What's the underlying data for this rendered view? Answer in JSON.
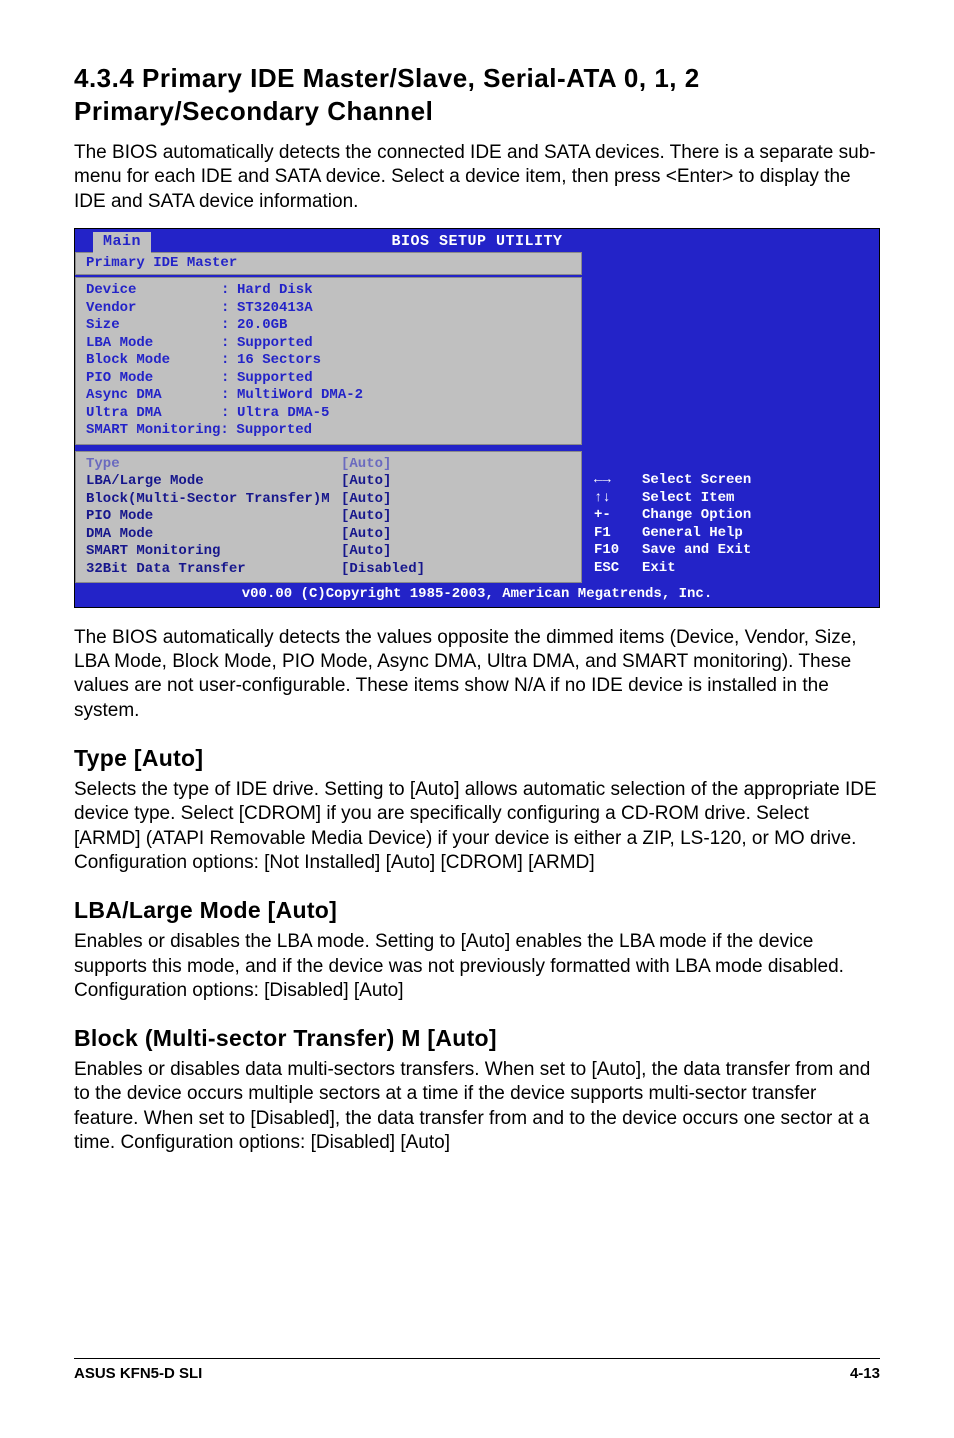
{
  "section_title": "4.3.4 Primary IDE Master/Slave, Serial-ATA 0, 1, 2 Primary/Secondary Channel",
  "intro": "The BIOS automatically detects the connected IDE and SATA devices. There is a separate sub-menu for each IDE and SATA device. Select a device item, then press <Enter> to display the IDE and SATA device information.",
  "bios": {
    "utility_title": "BIOS SETUP UTILITY",
    "tab": "Main",
    "panel_title": "Primary IDE Master",
    "info": [
      {
        "label": "Device",
        "value": "Hard Disk"
      },
      {
        "label": "Vendor",
        "value": "ST320413A"
      },
      {
        "label": "Size",
        "value": "20.0GB"
      },
      {
        "label": "LBA Mode",
        "value": "Supported"
      },
      {
        "label": "Block Mode",
        "value": "16 Sectors"
      },
      {
        "label": "PIO Mode",
        "value": "Supported"
      },
      {
        "label": "Async DMA",
        "value": "MultiWord DMA-2"
      },
      {
        "label": "Ultra DMA",
        "value": "Ultra DMA-5"
      },
      {
        "label": "SMART Monitoring",
        "value": "Supported",
        "nocolon": true
      }
    ],
    "options": [
      {
        "label": "Type",
        "value": "[Auto]",
        "dim": true
      },
      {
        "label": "LBA/Large Mode",
        "value": "[Auto]"
      },
      {
        "label": "Block(Multi-Sector Transfer)M",
        "value": "[Auto]"
      },
      {
        "label": "PIO Mode",
        "value": "[Auto]"
      },
      {
        "label": "DMA Mode",
        "value": "[Auto]"
      },
      {
        "label": "SMART Monitoring",
        "value": "[Auto]"
      },
      {
        "label": "32Bit Data Transfer",
        "value": "[Disabled]"
      }
    ],
    "nav": [
      {
        "key": "←→",
        "label": "Select Screen"
      },
      {
        "key": "↑↓",
        "label": "Select Item"
      },
      {
        "key": "+-",
        "label": "Change Option"
      },
      {
        "key": "F1",
        "label": "General Help"
      },
      {
        "key": "F10",
        "label": "Save and Exit"
      },
      {
        "key": "ESC",
        "label": "Exit"
      }
    ],
    "footer": "v00.00 (C)Copyright 1985-2003, American Megatrends, Inc."
  },
  "para2": "The BIOS automatically detects the values opposite the dimmed items (Device, Vendor, Size, LBA Mode, Block Mode, PIO Mode, Async DMA, Ultra DMA, and SMART monitoring). These values are not user-configurable. These items show N/A if no IDE device is installed in the system.",
  "type_heading": "Type [Auto]",
  "type_body": "Selects the type of IDE drive. Setting to [Auto] allows automatic selection of the appropriate IDE device type. Select [CDROM] if you are specifically configuring a CD-ROM drive. Select [ARMD] (ATAPI Removable Media Device) if your device is either a ZIP, LS-120, or MO drive.\nConfiguration options: [Not Installed] [Auto] [CDROM] [ARMD]",
  "lba_heading": "LBA/Large Mode [Auto]",
  "lba_body": "Enables or disables the LBA mode. Setting to [Auto] enables the LBA mode if the device supports this mode, and if the device was not previously formatted with LBA mode disabled. Configuration options: [Disabled] [Auto]",
  "block_heading": "Block (Multi-sector Transfer) M [Auto]",
  "block_body": "Enables or disables data multi-sectors transfers. When set to [Auto], the data transfer from and to the device occurs multiple sectors at a time if the device supports multi-sector transfer feature. When set to [Disabled], the data transfer from and to the device occurs one sector at a time. Configuration options: [Disabled] [Auto]",
  "footer_left": "ASUS KFN5-D SLI",
  "footer_right": "4-13"
}
